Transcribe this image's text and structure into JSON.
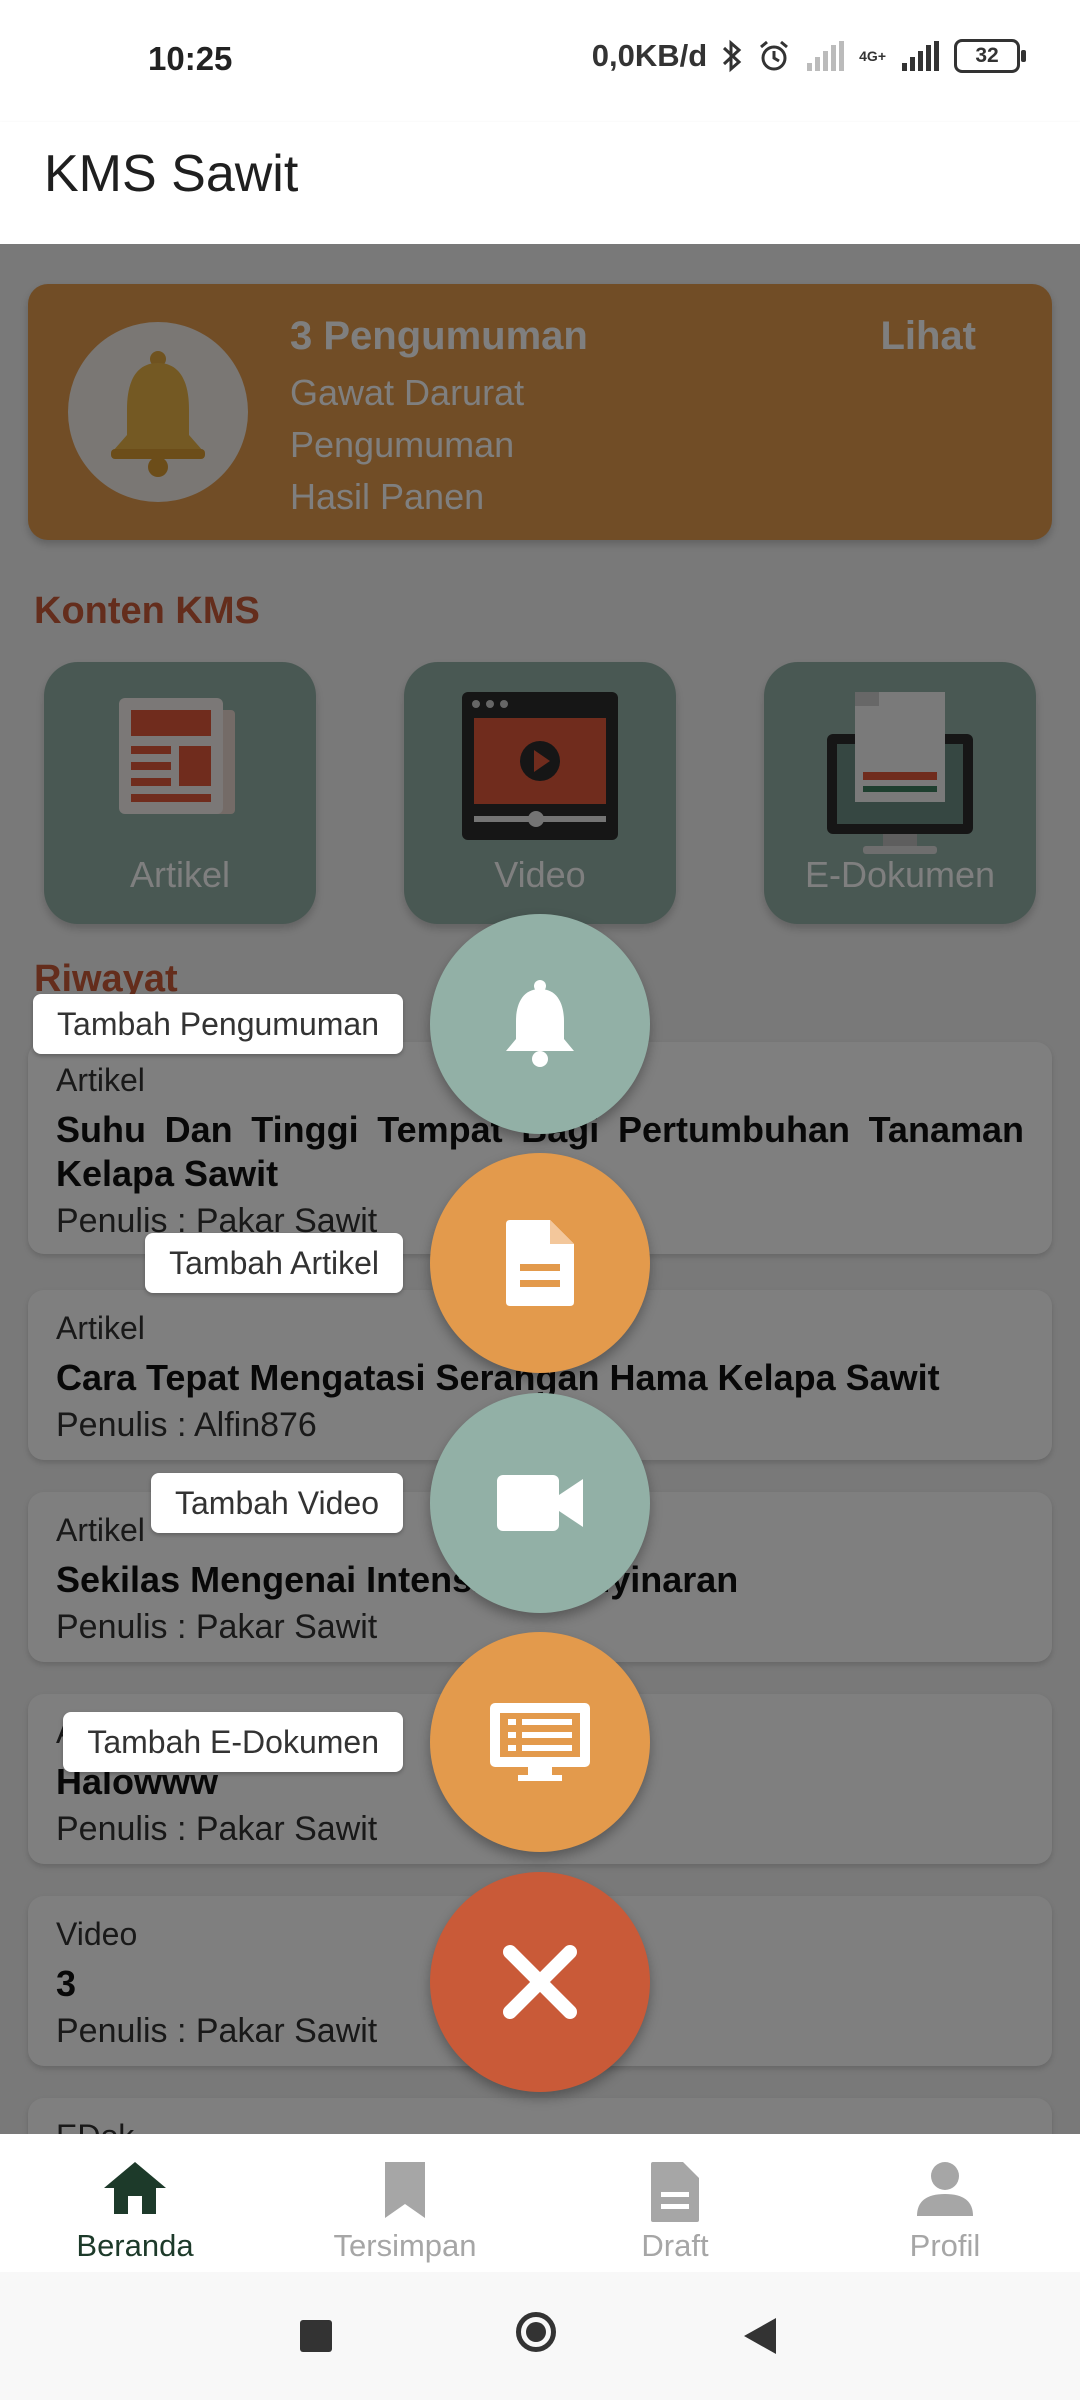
{
  "status": {
    "time": "10:25",
    "speed": "0,0KB/d",
    "network": "4G+",
    "battery": "32"
  },
  "app": {
    "title": "KMS Sawit"
  },
  "announcement": {
    "title": "3 Pengumuman",
    "lines": [
      "Gawat Darurat",
      "Pengumuman",
      "Hasil Panen"
    ],
    "action": "Lihat"
  },
  "sections": {
    "content_title": "Konten KMS",
    "history_title": "Riwayat"
  },
  "tiles": [
    {
      "label": "Artikel",
      "icon": "article-icon"
    },
    {
      "label": "Video",
      "icon": "video-icon"
    },
    {
      "label": "E-Dokumen",
      "icon": "document-icon"
    }
  ],
  "history": [
    {
      "type": "Artikel",
      "title": "Suhu Dan Tinggi Tempat Bagi Pertumbuhan Tanaman Kelapa Sawit",
      "author": "Penulis : Pakar Sawit"
    },
    {
      "type": "Artikel",
      "title": "Cara Tepat Mengatasi Serangan Hama Kelapa Sawit",
      "author": "Penulis : Alfin876"
    },
    {
      "type": "Artikel",
      "title": "Sekilas Mengenai Intensitas Penyinaran",
      "author": "Penulis : Pakar Sawit"
    },
    {
      "type": "Artikel",
      "title": "Halowww",
      "author": "Penulis : Pakar Sawit"
    },
    {
      "type": "Video",
      "title": "3",
      "author": "Penulis : Pakar Sawit"
    },
    {
      "type": "EDok",
      "title": "",
      "author": ""
    }
  ],
  "fab_menu": [
    {
      "label": "Tambah Pengumuman",
      "icon": "bell-icon"
    },
    {
      "label": "Tambah Artikel",
      "icon": "document-icon"
    },
    {
      "label": "Tambah Video",
      "icon": "videocam-icon"
    },
    {
      "label": "Tambah E-Dokumen",
      "icon": "monitor-icon"
    }
  ],
  "fab_close": {
    "icon": "close-icon"
  },
  "bottom_nav": [
    {
      "label": "Beranda",
      "icon": "home-icon",
      "active": true
    },
    {
      "label": "Tersimpan",
      "icon": "bookmark-icon"
    },
    {
      "label": "Draft",
      "icon": "draft-icon"
    },
    {
      "label": "Profil",
      "icon": "person-icon"
    }
  ],
  "colors": {
    "accent_orange": "#e39a4c",
    "teal": "#92b0a6",
    "red": "#c95a38",
    "nav_active": "#1d3a2a"
  }
}
